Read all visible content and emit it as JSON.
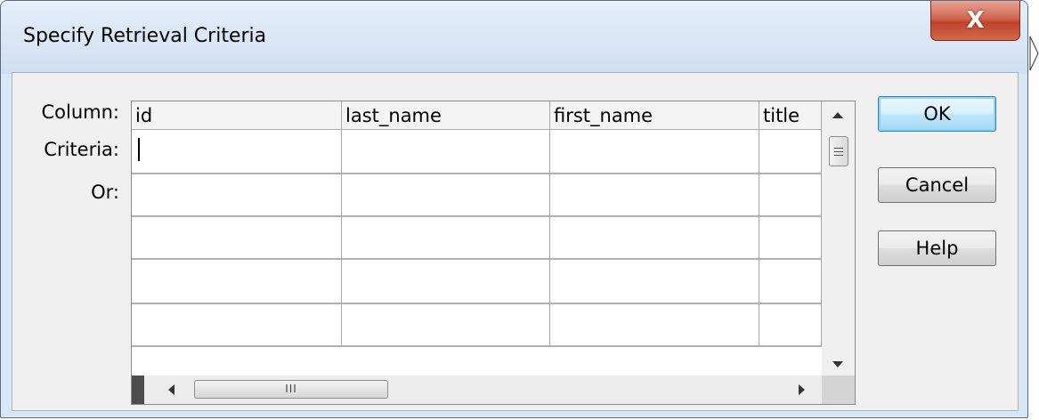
{
  "dialog": {
    "title": "Specify Retrieval Criteria",
    "close_icon": "close-x-icon",
    "close_label": "X"
  },
  "row_labels": {
    "column": "Column:",
    "criteria": "Criteria:",
    "or": "Or:"
  },
  "grid": {
    "columns": [
      "id",
      "last_name",
      "first_name",
      "title"
    ],
    "row_count": 5,
    "rows": [
      [
        "",
        "",
        "",
        ""
      ],
      [
        "",
        "",
        "",
        ""
      ],
      [
        "",
        "",
        "",
        ""
      ],
      [
        "",
        "",
        "",
        ""
      ],
      [
        "",
        "",
        "",
        ""
      ]
    ]
  },
  "scrollbars": {
    "horizontal_thumb_grip": "III",
    "vertical_position": 0.0,
    "horizontal_position": 0.0
  },
  "buttons": {
    "ok": "OK",
    "cancel": "Cancel",
    "help": "Help"
  },
  "colors": {
    "frame": "#d9e6f5",
    "close_button": "#c7422c",
    "default_button_border": "#3c7fb1"
  }
}
